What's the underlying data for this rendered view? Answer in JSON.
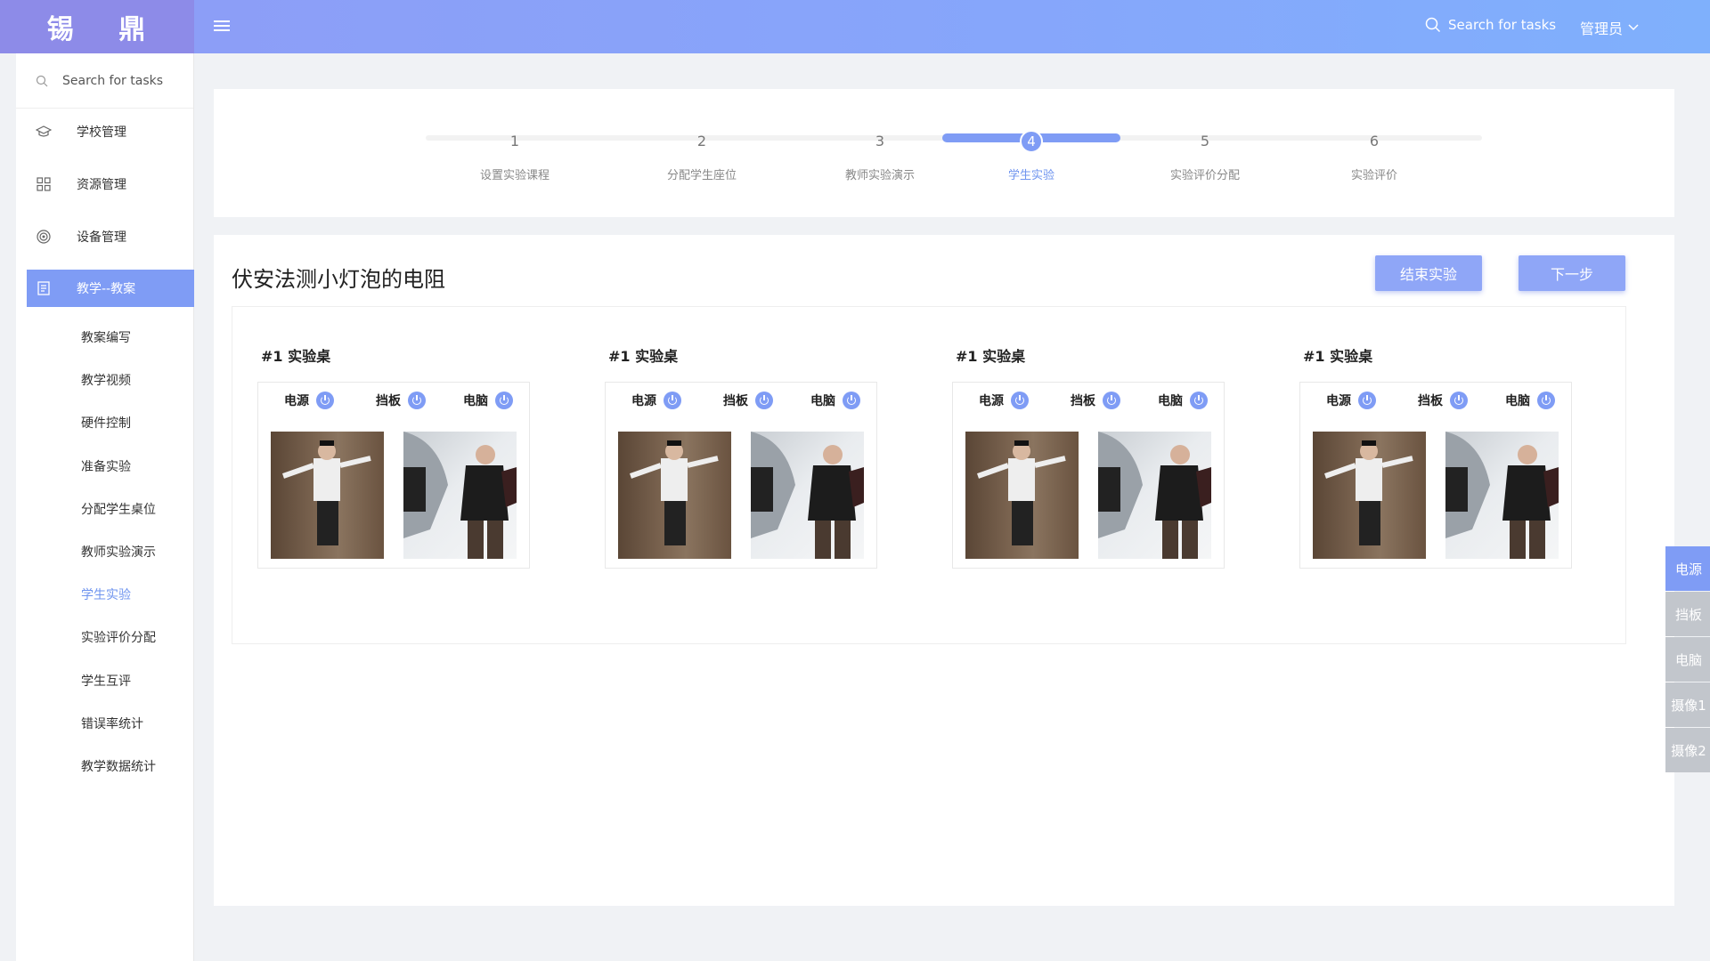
{
  "header": {
    "logo": "锡 鼎",
    "search_placeholder": "Search for tasks",
    "user": "管理员"
  },
  "sidebar": {
    "search_placeholder": "Search for tasks",
    "items": [
      {
        "label": "学校管理",
        "icon": "graduation-cap-icon"
      },
      {
        "label": "资源管理",
        "icon": "grid-icon"
      },
      {
        "label": "设备管理",
        "icon": "target-icon"
      },
      {
        "label": "教学--教案",
        "icon": "document-icon",
        "active": true
      }
    ],
    "subitems": [
      "教案编写",
      "教学视频",
      "硬件控制",
      "准备实验",
      "分配学生桌位",
      "教师实验演示",
      "学生实验",
      "实验评价分配",
      "学生互评",
      "错误率统计",
      "教学数据统计"
    ],
    "active_subitem": "学生实验"
  },
  "steps": {
    "current": 4,
    "items": [
      {
        "num": "1",
        "label": "设置实验课程"
      },
      {
        "num": "2",
        "label": "分配学生座位"
      },
      {
        "num": "3",
        "label": "教师实验演示"
      },
      {
        "num": "4",
        "label": "学生实验"
      },
      {
        "num": "5",
        "label": "实验评价分配"
      },
      {
        "num": "6",
        "label": "实验评价"
      }
    ]
  },
  "main": {
    "title": "伏安法测小灯泡的电阻",
    "end_button": "结束实验",
    "next_button": "下一步",
    "desks": [
      {
        "title": "#1 实验桌",
        "controls": [
          "电源",
          "挡板",
          "电脑"
        ]
      },
      {
        "title": "#1 实验桌",
        "controls": [
          "电源",
          "挡板",
          "电脑"
        ]
      },
      {
        "title": "#1 实验桌",
        "controls": [
          "电源",
          "挡板",
          "电脑"
        ]
      },
      {
        "title": "#1 实验桌",
        "controls": [
          "电源",
          "挡板",
          "电脑"
        ]
      }
    ]
  },
  "float_tabs": [
    "电源",
    "挡板",
    "电脑",
    "摄像1",
    "摄像2"
  ],
  "colors": {
    "accent": "#7f9cf5",
    "header_start": "#8e9cf6",
    "header_end": "#7fb0fc"
  }
}
